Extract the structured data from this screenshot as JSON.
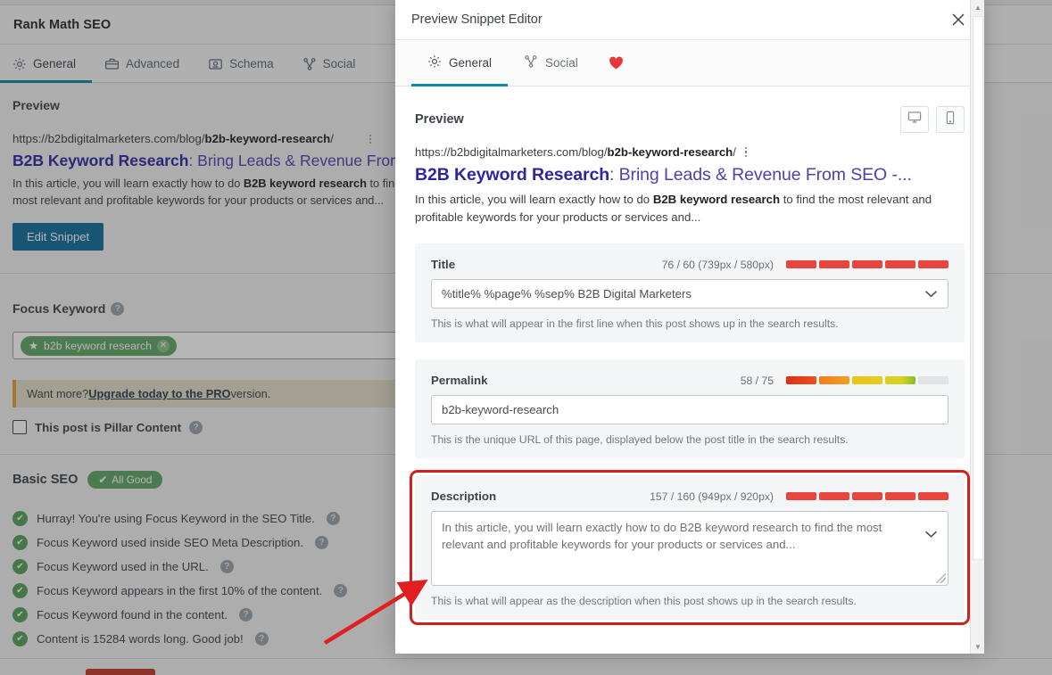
{
  "background": {
    "panel_title": "Rank Math SEO",
    "tabs": [
      {
        "label": "General",
        "icon": "gear-icon",
        "active": true
      },
      {
        "label": "Advanced",
        "icon": "briefcase-icon",
        "active": false
      },
      {
        "label": "Schema",
        "icon": "schema-icon",
        "active": false
      },
      {
        "label": "Social",
        "icon": "share-nodes-icon",
        "active": false
      }
    ],
    "preview_label": "Preview",
    "snippet": {
      "url_prefix": "https://b2bdigitalmarketers.com/blog/",
      "url_slug": "b2b-keyword-research",
      "url_suffix": "/",
      "title_bold": "B2B Keyword Research",
      "title_rest": ": Bring Leads & Revenue From SEO",
      "desc_part1": "In this article, you will learn exactly how to do ",
      "desc_bold": "B2B keyword research",
      "desc_part2": " to find the most relevant and profitable keywords for your products or services and..."
    },
    "edit_snippet_label": "Edit Snippet",
    "focus_keyword_label": "Focus Keyword",
    "focus_keyword_tag": "b2b keyword research",
    "pro_notice_prefix": "Want more? ",
    "pro_notice_link": "Upgrade today to the PRO",
    "pro_notice_suffix": " version.",
    "pillar_label": "This post is Pillar Content",
    "basic_seo_label": "Basic SEO",
    "all_good_label": "All Good",
    "seo_items": [
      "Hurray! You're using Focus Keyword in the SEO Title.",
      "Focus Keyword used inside SEO Meta Description.",
      "Focus Keyword used in the URL.",
      "Focus Keyword appears in the first 10% of the content.",
      "Focus Keyword found in the content.",
      "Content is 15284 words long. Good job!"
    ]
  },
  "modal": {
    "title": "Preview Snippet Editor",
    "close_icon": "close-icon",
    "tabs": [
      {
        "label": "General",
        "icon": "gear-icon",
        "active": true
      },
      {
        "label": "Social",
        "icon": "share-nodes-icon",
        "active": false
      }
    ],
    "heart_icon": "heart-icon",
    "preview_heading": "Preview",
    "device_buttons": [
      {
        "name": "desktop-preview-button",
        "icon": "monitor-icon",
        "selected": true
      },
      {
        "name": "mobile-preview-button",
        "icon": "mobile-icon",
        "selected": false
      }
    ],
    "snippet": {
      "url_prefix": "https://b2bdigitalmarketers.com/blog/",
      "url_slug": "b2b-keyword-research",
      "url_suffix": "/",
      "title_bold": "B2B Keyword Research",
      "title_rest": ": Bring Leads & Revenue From SEO -...",
      "desc_part1": "In this article, you will learn exactly how to do ",
      "desc_bold": "B2B keyword research",
      "desc_part2": " to find the most relevant and profitable keywords for your products or services and..."
    },
    "fields": [
      {
        "key": "title",
        "label": "Title",
        "counter": "76 / 60 (739px / 580px)",
        "value": "%title% %page% %sep% B2B Digital Marketers",
        "help": "This is what will appear in the first line when this post shows up in the search results.",
        "bar_colors": [
          "#e8453c",
          "#e8453c",
          "#e8453c",
          "#e8453c",
          "#e8453c"
        ],
        "highlighted": false
      },
      {
        "key": "permalink",
        "label": "Permalink",
        "counter": "58 / 75",
        "value": "b2b-keyword-research",
        "help": "This is the unique URL of this page, displayed below the post title in the search results.",
        "bar_colors": [
          "#e1391f",
          "#f08d20",
          "#edc31c",
          "#a6c62c",
          "#e2e3e4"
        ],
        "highlighted": false
      },
      {
        "key": "description",
        "label": "Description",
        "counter": "157 / 160 (949px / 920px)",
        "value": "In this article, you will learn exactly how to do B2B keyword research to find the most relevant and profitable keywords for your products or services and...",
        "help": "This is what will appear as the description when this post shows up in the search results.",
        "bar_colors": [
          "#e8453c",
          "#e8453c",
          "#e8453c",
          "#e8453c",
          "#e8453c"
        ],
        "highlighted": true
      }
    ]
  },
  "annotation": {
    "arrow_color": "#e02020",
    "highlight_color": "#d4201b"
  }
}
